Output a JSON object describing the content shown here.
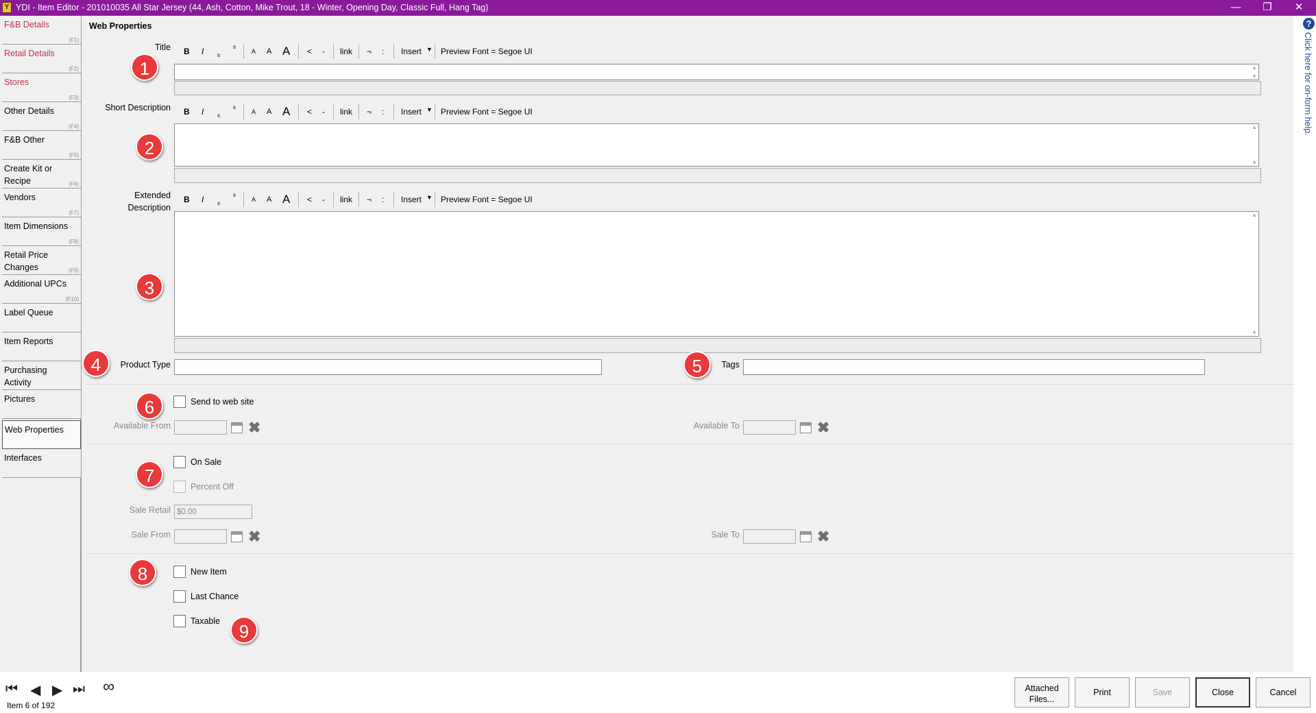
{
  "window": {
    "title": "YDI - Item Editor - 201010035 All Star Jersey (44, Ash, Cotton, Mike Trout, 18 - Winter, Opening Day, Classic Full, Hang Tag)",
    "minimize": "—",
    "restore": "❐",
    "close": "✕"
  },
  "sidebar": {
    "items": [
      {
        "label": "F&B Details",
        "key": "(F1)"
      },
      {
        "label": "Retail Details",
        "key": "(F2)"
      },
      {
        "label": "Stores",
        "key": "(F3)"
      },
      {
        "label": "Other Details",
        "key": "(F4)"
      },
      {
        "label": "F&B Other",
        "key": "(F5)"
      },
      {
        "label": "Create Kit or Recipe",
        "key": "(F6)"
      },
      {
        "label": "Vendors",
        "key": "(F7)"
      },
      {
        "label": "Item Dimensions",
        "key": "(F8)"
      },
      {
        "label": "Retail Price Changes",
        "key": "(F9)"
      },
      {
        "label": "Additional UPCs",
        "key": "(F10)"
      },
      {
        "label": "Label Queue",
        "key": ""
      },
      {
        "label": "Item Reports",
        "key": ""
      },
      {
        "label": "Purchasing Activity",
        "key": ""
      },
      {
        "label": "Pictures",
        "key": ""
      },
      {
        "label": "Web Properties",
        "key": ""
      },
      {
        "label": "Interfaces",
        "key": ""
      }
    ]
  },
  "section_title": "Web Properties",
  "toolbar": {
    "bold": "B",
    "italic": "I",
    "subscript": "s",
    "superscript": "s",
    "font_small": "A",
    "font_medium": "A",
    "font_large": "A",
    "lt": "<",
    "dash": "-",
    "link": "link",
    "not": "¬",
    "colon": ":",
    "insert": "Insert",
    "preview": "Preview Font = Segoe UI"
  },
  "fields": {
    "title_label": "Title",
    "short_desc_label": "Short Description",
    "extended_desc_label_1": "Extended",
    "extended_desc_label_2": "Description",
    "product_type_label": "Product Type",
    "tags_label": "Tags",
    "send_to_web": "Send to web site",
    "available_from": "Available From",
    "available_to": "Available To",
    "on_sale": "On Sale",
    "percent_off": "Percent Off",
    "sale_retail_label": "Sale Retail",
    "sale_retail_value": "$0.00",
    "sale_from": "Sale From",
    "sale_to": "Sale To",
    "new_item": "New Item",
    "last_chance": "Last Chance",
    "taxable": "Taxable"
  },
  "badges": [
    "1",
    "2",
    "3",
    "4",
    "5",
    "6",
    "7",
    "8",
    "9"
  ],
  "help_text": "Click here for on-form help.",
  "help_icon": "?",
  "footer": {
    "nav_first": "⏮",
    "nav_prev": "◀",
    "nav_next": "▶",
    "nav_last": "⏭",
    "nav_infinite": "∞",
    "record_status": "Item 6 of 192",
    "btn_attached_1": "Attached",
    "btn_attached_2": "Files...",
    "btn_print": "Print",
    "btn_save": "Save",
    "btn_close": "Close",
    "btn_cancel": "Cancel"
  },
  "colors": {
    "titlebar": "#8b1a9b",
    "badge": "#e8393b",
    "nav_red_text": "#c0304a",
    "help_blue": "#1e4aa0"
  }
}
